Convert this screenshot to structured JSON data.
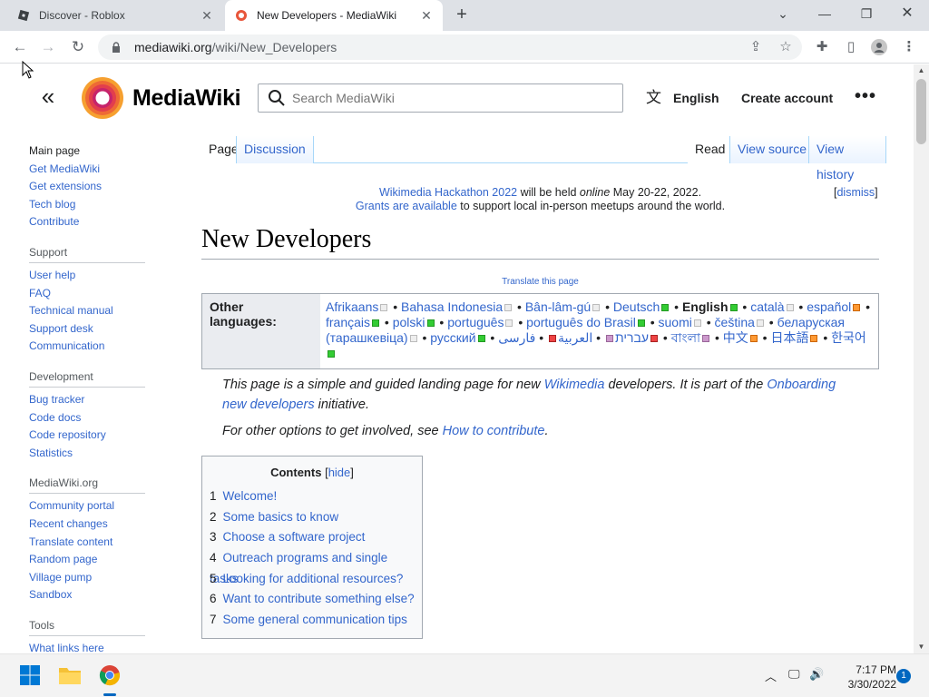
{
  "browser": {
    "tabs": [
      {
        "title": "Discover - Roblox",
        "active": false
      },
      {
        "title": "New Developers - MediaWiki",
        "active": true
      }
    ],
    "url_host": "mediawiki.org",
    "url_path": "/wiki/New_Developers"
  },
  "header": {
    "wordmark": "MediaWiki",
    "search_placeholder": "Search MediaWiki",
    "language": "English",
    "create_account": "Create account"
  },
  "sidebar": {
    "main": [
      "Main page",
      "Get MediaWiki",
      "Get extensions",
      "Tech blog",
      "Contribute"
    ],
    "sections": [
      {
        "heading": "Support",
        "links": [
          "User help",
          "FAQ",
          "Technical manual",
          "Support desk",
          "Communication"
        ]
      },
      {
        "heading": "Development",
        "links": [
          "Bug tracker",
          "Code docs",
          "Code repository",
          "Statistics"
        ]
      },
      {
        "heading": "MediaWiki.org",
        "links": [
          "Community portal",
          "Recent changes",
          "Translate content",
          "Random page",
          "Village pump",
          "Sandbox"
        ]
      },
      {
        "heading": "Tools",
        "links": [
          "What links here"
        ]
      }
    ]
  },
  "page_tabs": {
    "page": "Page",
    "discussion": "Discussion",
    "read": "Read",
    "view_source": "View source",
    "view_history": "View history"
  },
  "sitenotice": {
    "hackathon_link": "Wikimedia Hackathon 2022",
    "held": " will be held ",
    "online": "online",
    "dates": " May 20-22, 2022.",
    "grants_link": "Grants are available",
    "grants_rest": " to support local in-person meetups around the world.",
    "dismiss_open": "[",
    "dismiss": "dismiss",
    "dismiss_close": "]"
  },
  "content": {
    "title": "New Developers",
    "translate": "Translate this page",
    "other_languages_label": "Other languages:",
    "languages": [
      {
        "name": "Afrikaans",
        "mark": "w"
      },
      {
        "name": "Bahasa Indonesia",
        "mark": "w"
      },
      {
        "name": "Bân-lâm-gú",
        "mark": "w"
      },
      {
        "name": "Deutsch",
        "mark": "g"
      },
      {
        "name": "English",
        "mark": "g",
        "current": true
      },
      {
        "name": "català",
        "mark": "w"
      },
      {
        "name": "español",
        "mark": "o"
      },
      {
        "name": "français",
        "mark": "g"
      },
      {
        "name": "polski",
        "mark": "g"
      },
      {
        "name": "português",
        "mark": "w"
      },
      {
        "name": "português do Brasil",
        "mark": "g"
      },
      {
        "name": "suomi",
        "mark": "w"
      },
      {
        "name": "čeština",
        "mark": "w"
      },
      {
        "name": "беларуская (тарашкевіца)",
        "mark": "w"
      },
      {
        "name": "русский",
        "mark": "g"
      },
      {
        "name": "עברית",
        "mark": "p"
      },
      {
        "name": "العربية",
        "mark": "r"
      },
      {
        "name": "فارسی",
        "mark": "r"
      },
      {
        "name": "বাংলা",
        "mark": "p"
      },
      {
        "name": "中文",
        "mark": "o"
      },
      {
        "name": "日本語",
        "mark": "o"
      },
      {
        "name": "한국어",
        "mark": "g"
      }
    ],
    "intro_1": "This page is a simple and guided landing page for new ",
    "intro_link_wikimedia": "Wikimedia",
    "intro_2": " developers. It is part of the ",
    "intro_link_onboarding": "Onboarding new developers",
    "intro_3": " initiative.",
    "other_options": "For other options to get involved, see ",
    "how_to_contribute": "How to contribute",
    "period": "."
  },
  "toc": {
    "title": "Contents",
    "hide_open": "[",
    "hide": "hide",
    "hide_close": "]",
    "items": [
      {
        "num": "1",
        "text": "Welcome!"
      },
      {
        "num": "2",
        "text": "Some basics to know"
      },
      {
        "num": "3",
        "text": "Choose a software project"
      },
      {
        "num": "4",
        "text": "Outreach programs and single tasks"
      },
      {
        "num": "5",
        "text": "Looking for additional resources?"
      },
      {
        "num": "6",
        "text": "Want to contribute something else?"
      },
      {
        "num": "7",
        "text": "Some general communication tips"
      }
    ]
  },
  "taskbar": {
    "time": "7:17 PM",
    "date": "3/30/2022",
    "notifications": "1"
  },
  "colors": {
    "link": "#3366cc",
    "text": "#202122",
    "border": "#a2a9b1",
    "tab_border": "#a7d7f9"
  }
}
